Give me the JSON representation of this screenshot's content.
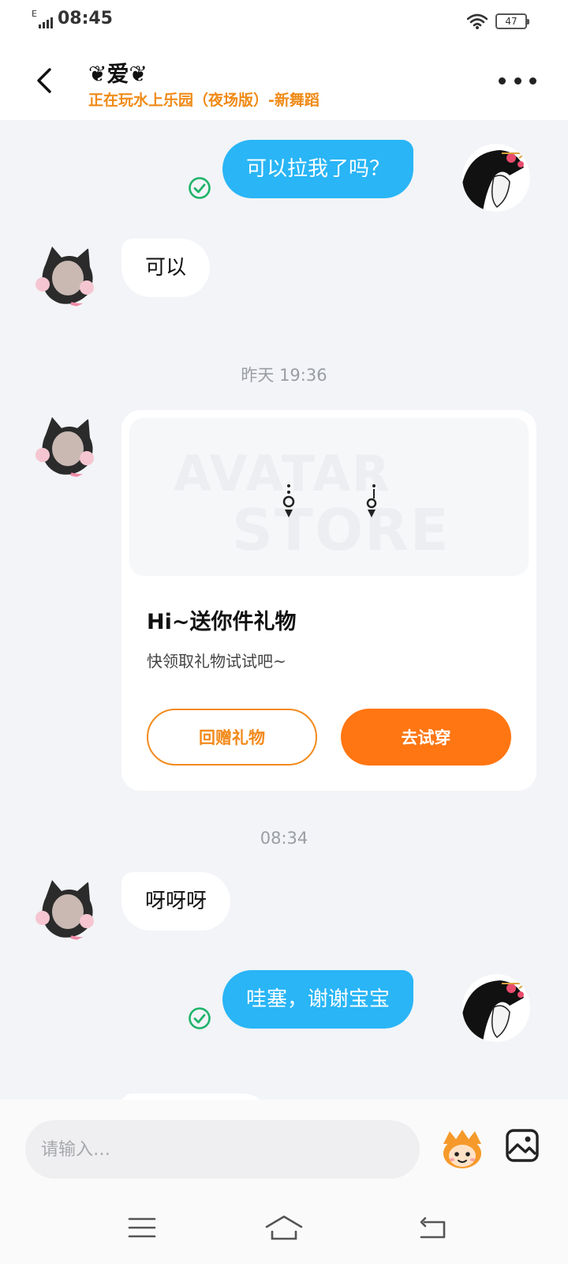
{
  "status_bar": {
    "network": "E",
    "time": "08:45",
    "battery": "47"
  },
  "header": {
    "title": "❦爱❦",
    "subtitle": "正在玩水上乐园（夜场版）-新舞蹈"
  },
  "messages": {
    "m1": "可以拉我了吗？",
    "m2": "可以",
    "m3": "呀呀呀",
    "m4": "哇塞，谢谢宝宝"
  },
  "timestamps": {
    "t1": "昨天 19:36",
    "t2": "08:34"
  },
  "gift_card": {
    "watermark_top": "AVATAR",
    "watermark_bottom": "STORE",
    "title": "Hi~送你件礼物",
    "desc": "快领取礼物试试吧~",
    "return_gift_label": "回赠礼物",
    "try_on_label": "去试穿"
  },
  "input": {
    "placeholder": "请输入…"
  },
  "colors": {
    "outgoing_bubble": "#29b5f6",
    "accent_orange": "#ff7612",
    "subtitle_orange": "#f08a16",
    "check_green": "#1fb36b"
  },
  "icons": {
    "back": "chevron-left-icon",
    "more": "more-dots-icon",
    "sent": "check-circle-icon",
    "emoji": "mascot-emoji-icon",
    "image": "image-icon",
    "nav_menu": "menu-icon",
    "nav_home": "home-icon",
    "nav_back": "back-icon"
  }
}
